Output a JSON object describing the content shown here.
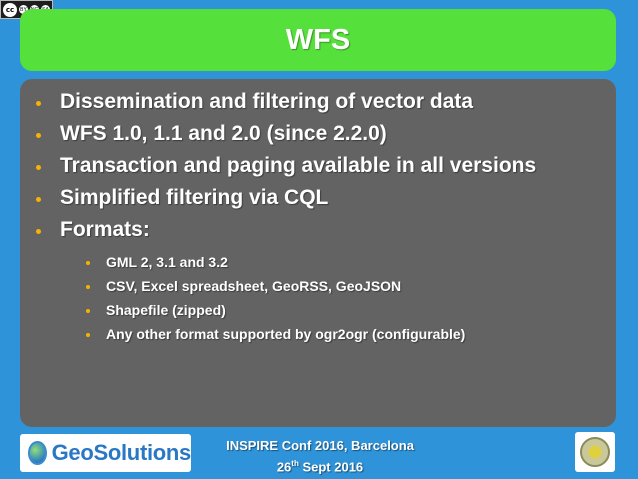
{
  "license_badge": {
    "icons": [
      "cc-icon",
      "by-icon",
      "nc-icon",
      "sa-icon"
    ],
    "cc": "cc",
    "labels": [
      "BY",
      "NC",
      "SA"
    ]
  },
  "slide": {
    "title": "WFS",
    "bullets": [
      "Dissemination and filtering of vector data",
      "WFS 1.0, 1.1 and 2.0 (since 2.2.0)",
      "Transaction and paging available in all versions",
      "Simplified filtering via CQL",
      "Formats:"
    ],
    "format_items": [
      "GML 2, 3.1 and 3.2",
      "CSV, Excel spreadsheet, GeoRSS, GeoJSON",
      "Shapefile (zipped)",
      "Any other format supported by ogr2ogr (configurable)"
    ]
  },
  "footer": {
    "logo_text": "GeoSolutions",
    "conference": "INSPIRE Conf 2016, Barcelona",
    "date_day": "26",
    "date_suffix": "th",
    "date_rest": " Sept 2016"
  },
  "colors": {
    "background": "#2f93d9",
    "title_bar": "#56e03b",
    "content_panel": "#636363",
    "bullet": "#f4b400"
  }
}
